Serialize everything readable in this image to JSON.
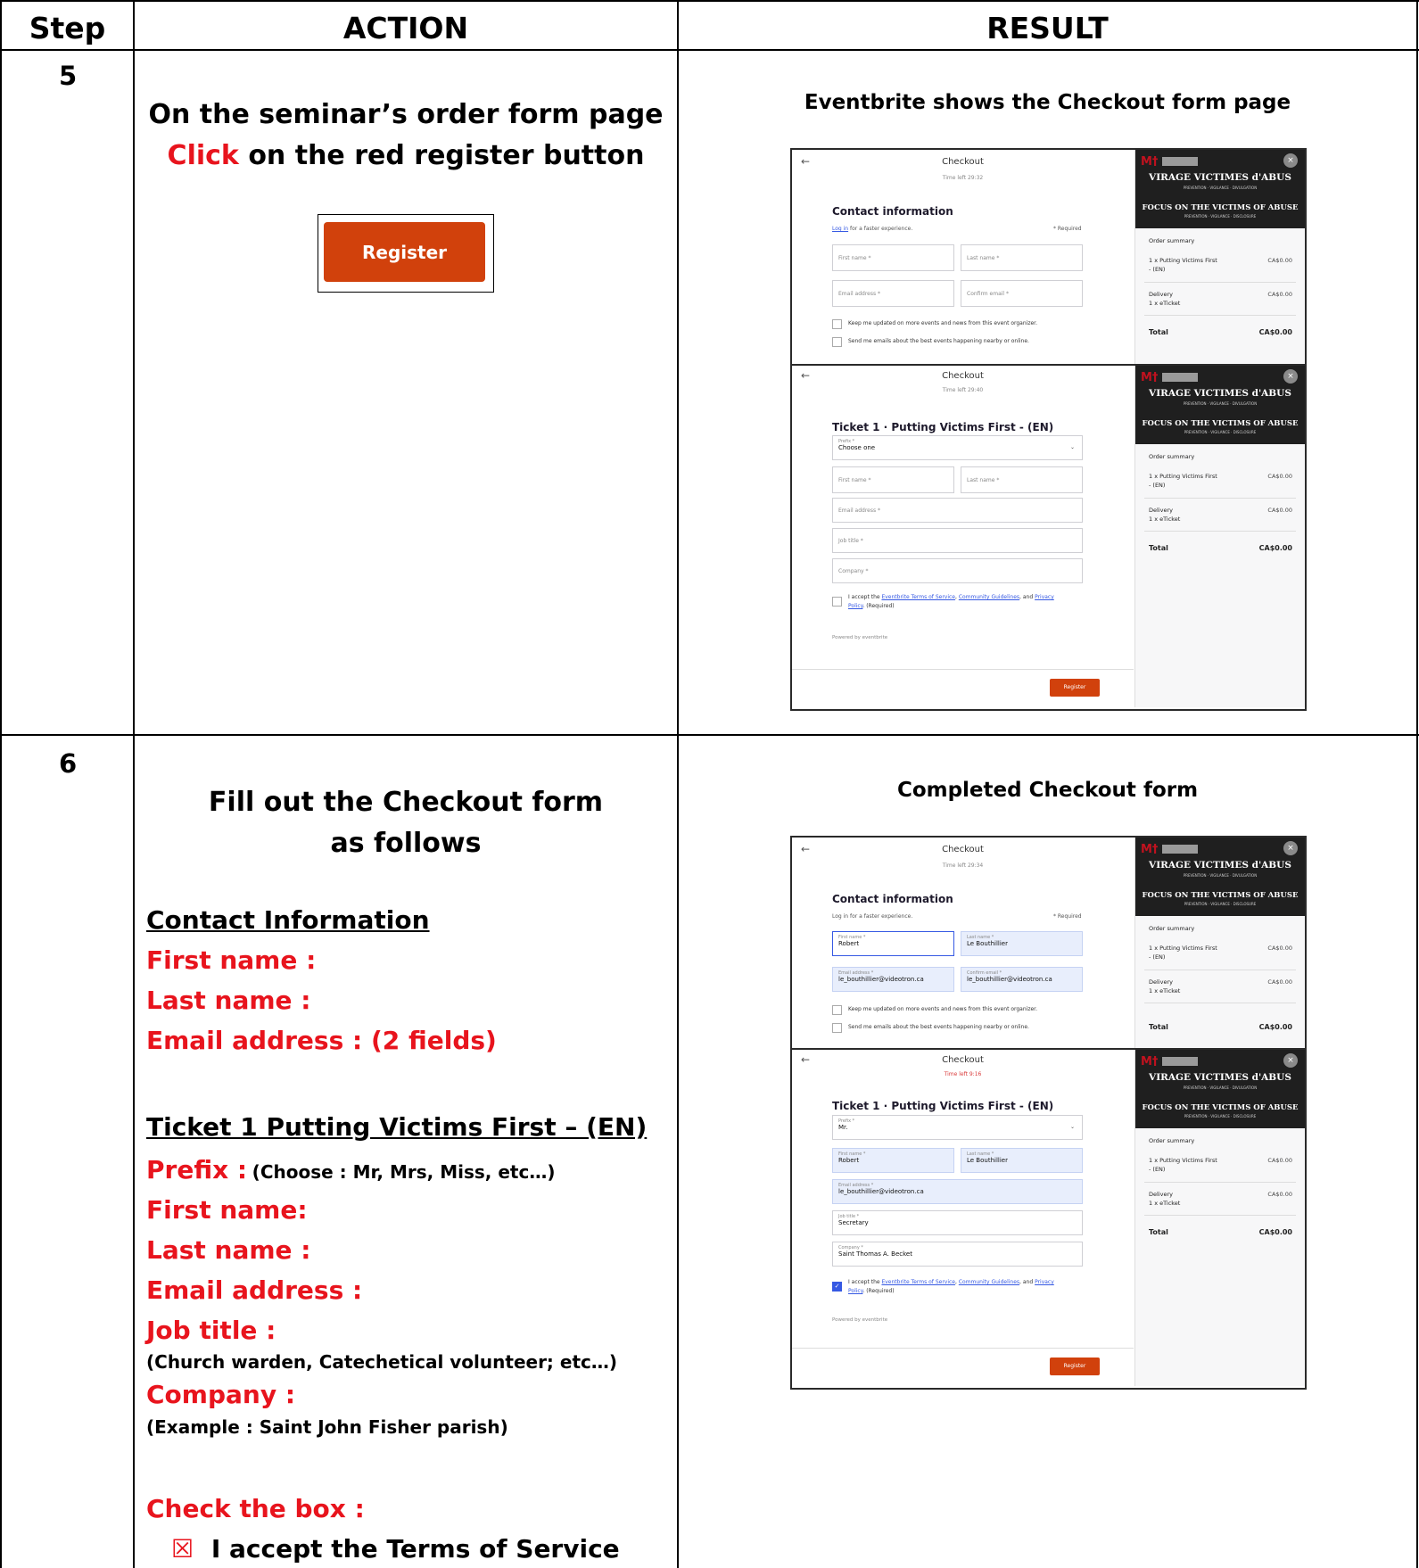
{
  "header": {
    "step": "Step",
    "action": "ACTION",
    "result": "RESULT"
  },
  "rows": [
    {
      "step": "5",
      "action_line1": "On the seminar’s order form page",
      "action_click": "Click",
      "action_line2_rest": " on the red register button",
      "button_label": "Register",
      "result_caption": "Eventbrite shows the Checkout form page"
    },
    {
      "step": "6",
      "action_title1": "Fill out the Checkout form",
      "action_title2": "as follows",
      "contact_heading": "Contact Information",
      "contact_items": [
        "First name :",
        "Last name :",
        "Email address : (2 fields)"
      ],
      "ticket_heading": "Ticket 1 Putting Victims First – (EN)",
      "prefix_label": "Prefix :",
      "prefix_hint": "(Choose : Mr, Mrs, Miss, etc…)",
      "ticket_items": [
        "First name:",
        "Last name :",
        "Email address :"
      ],
      "job_label": "Job title :",
      "job_hint": "(Church warden, Catechetical volunteer; etc…)",
      "company_label": "Company :",
      "company_hint": "(Example : Saint John Fisher parish)",
      "check_label": "Check the box :",
      "check_mark": "☒",
      "check_text": "I accept the Terms of Service",
      "result_caption": "Completed Checkout form"
    }
  ],
  "checkout": {
    "title": "Checkout",
    "back": "←",
    "time_left_a": "Time left 29:32",
    "time_left_b": "Time left 29:40",
    "time_left_c": "Time left 29:34",
    "time_left_d": "Time left 9:16",
    "contact_title": "Contact information",
    "login_link": "Log in",
    "login_rest": " for a faster experience.",
    "required": "* Required",
    "first_name": "First name *",
    "last_name": "Last name *",
    "email": "Email address *",
    "confirm_email": "Confirm email *",
    "keep_updated": "Keep me updated on more events and news from this event organizer.",
    "send_emails": "Send me emails about the best events happening nearby or online.",
    "ticket_title": "Ticket 1 · Putting Victims First - (EN)",
    "prefix": "Prefix *",
    "choose_one": "Choose one",
    "job_title": "Job title *",
    "company": "Company *",
    "accept_pre": "I accept the ",
    "tos": "Eventbrite Terms of Service",
    "guidelines": "Community Guidelines",
    "privacy": "Privacy",
    "policy": "Policy",
    "required_suffix": ". (Required)",
    "powered": "Powered by eventbrite",
    "register": "Register",
    "filled": {
      "first": "Robert",
      "last": "Le Bouthillier",
      "email": "le_bouthillier@videotron.ca",
      "prefix": "Mr.",
      "job": "Secretary",
      "company": "Saint Thomas A. Becket"
    }
  },
  "order_summary": {
    "title": "Order summary",
    "item1": "1 x Putting Victims First",
    "item1b": "- (EN)",
    "item1_price": "CA$0.00",
    "delivery": "Delivery",
    "delivery_sub": "1 x eTicket",
    "delivery_price": "CA$0.00",
    "total": "Total",
    "total_price": "CA$0.00"
  },
  "banner": {
    "logo": "M†",
    "line1": "VIRAGE VICTIMES d'ABUS",
    "line1_sub": "PREVENTION · VIGILANCE · DIVULGATION",
    "line2": "FOCUS ON THE VICTIMS OF ABUSE",
    "line2_sub": "PREVENTION · VIGILANCE · DISCLOSURE",
    "close": "×"
  },
  "colors": {
    "red_text": "#e8141d",
    "register_orange": "#d1410c",
    "link_blue": "#3659e3"
  }
}
